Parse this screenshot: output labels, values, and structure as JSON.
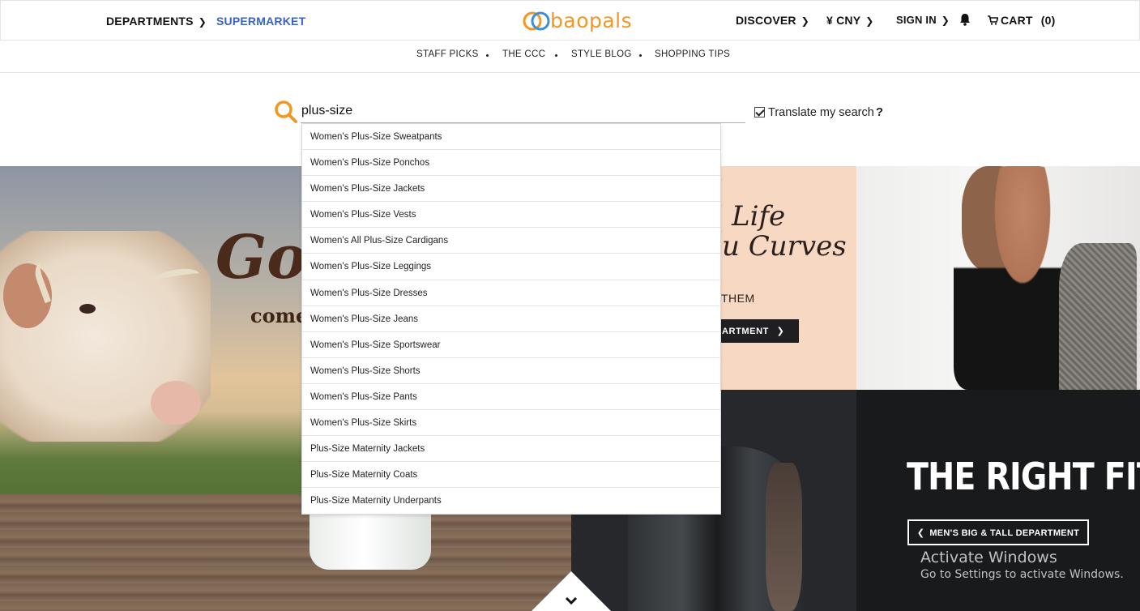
{
  "header": {
    "departments_label": "DEPARTMENTS",
    "supermarket_label": "SUPERMARKET",
    "logo_text": "baopals",
    "discover_label": "DISCOVER",
    "currency_label": "¥ CNY",
    "signin_label": "SIGN IN",
    "cart_label": "CART",
    "cart_count": "(0)",
    "accent_color": "#3a63c2",
    "brand_color": "#f39722",
    "icons": [
      "chevron-right-icon",
      "bell-icon",
      "cart-icon"
    ]
  },
  "subnav": {
    "items": [
      "STAFF PICKS",
      "THE CCC",
      "STYLE BLOG",
      "SHOPPING TIPS"
    ]
  },
  "search": {
    "value": "plus-size",
    "translate_label": "Translate my search",
    "translate_help": "?",
    "translate_checked": true,
    "icon": "search-icon"
  },
  "suggestions": [
    "Women's Plus-Size Sweatpants",
    "Women's Plus-Size Ponchos",
    "Women's Plus-Size Jackets",
    "Women's Plus-Size Vests",
    "Women's All Plus-Size Cardigans",
    "Women's Plus-Size Leggings",
    "Women's Plus-Size Dresses",
    "Women's Plus-Size Jeans",
    "Women's Plus-Size Sportswear",
    "Women's Plus-Size Shorts",
    "Women's Plus-Size Pants",
    "Women's Plus-Size Skirts",
    "Plus-Size Maternity Jackets",
    "Plus-Size Maternity Coats",
    "Plus-Size Maternity Underpants"
  ],
  "hero": {
    "cow_promo_title": "Goo",
    "cow_promo_sub": "come",
    "peach_title_line1": "Life",
    "peach_title_line2": "u Curves",
    "peach_sub": "THEM",
    "peach_button": "ARTMENT",
    "fit_title": "THE RIGHT FIT",
    "fit_button": "MEN'S BIG & TALL DEPARTMENT"
  },
  "watermark": {
    "title": "Activate Windows",
    "subtitle": "Go to Settings to activate Windows."
  }
}
